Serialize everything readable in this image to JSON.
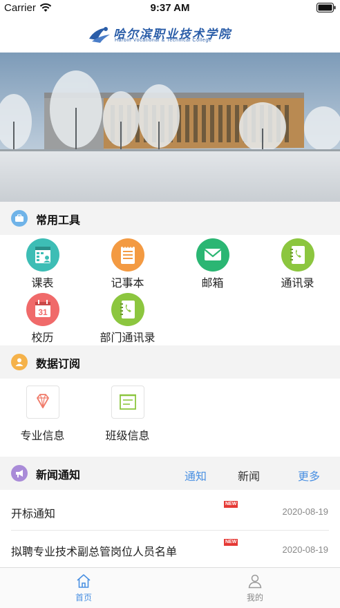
{
  "status_bar": {
    "carrier": "Carrier",
    "time": "9:37 AM",
    "icons": [
      "wifi-icon",
      "battery-icon"
    ]
  },
  "header": {
    "logo_cn": "哈尔滨职业技术学院",
    "logo_en": "Harbin Vocational & Technical College"
  },
  "tools_section": {
    "title": "常用工具",
    "icon": "briefcase-icon",
    "items": [
      {
        "label": "课表",
        "icon": "schedule-icon",
        "color": "#3dbdb5"
      },
      {
        "label": "记事本",
        "icon": "notepad-icon",
        "color": "#f39a42"
      },
      {
        "label": "邮箱",
        "icon": "mail-icon",
        "color": "#2bb673"
      },
      {
        "label": "通讯录",
        "icon": "contacts-book-icon",
        "color": "#8cc63f"
      },
      {
        "label": "校历",
        "icon": "calendar-icon",
        "color": "#f06a6a"
      },
      {
        "label": "部门通讯录",
        "icon": "phone-book-icon",
        "color": "#8cc63f"
      }
    ]
  },
  "subscribe_section": {
    "title": "数据订阅",
    "icon": "user-icon",
    "items": [
      {
        "label": "专业信息",
        "icon": "diamond-icon",
        "color": "#f07b6a"
      },
      {
        "label": "班级信息",
        "icon": "board-icon",
        "color": "#8cc63f"
      }
    ]
  },
  "news_section": {
    "title": "新闻通知",
    "icon": "megaphone-icon",
    "tabs": [
      "通知",
      "新闻"
    ],
    "more": "更多",
    "items": [
      {
        "title": "开标通知",
        "badge": "NEW",
        "date": "2020-08-19"
      },
      {
        "title": "拟聘专业技术副总管岗位人员名单",
        "badge": "NEW",
        "date": "2020-08-19"
      }
    ]
  },
  "tab_bar": {
    "items": [
      {
        "label": "首页",
        "icon": "home-icon",
        "active": true
      },
      {
        "label": "我的",
        "icon": "person-icon",
        "active": false
      }
    ]
  },
  "colors": {
    "accent": "#4a90e2",
    "section_bg": "#f3f3f3",
    "new_badge": "#e53935",
    "tools_badge": "#6fb3e8",
    "subscribe_badge": "#f5b24a",
    "news_badge": "#a98bd8"
  }
}
